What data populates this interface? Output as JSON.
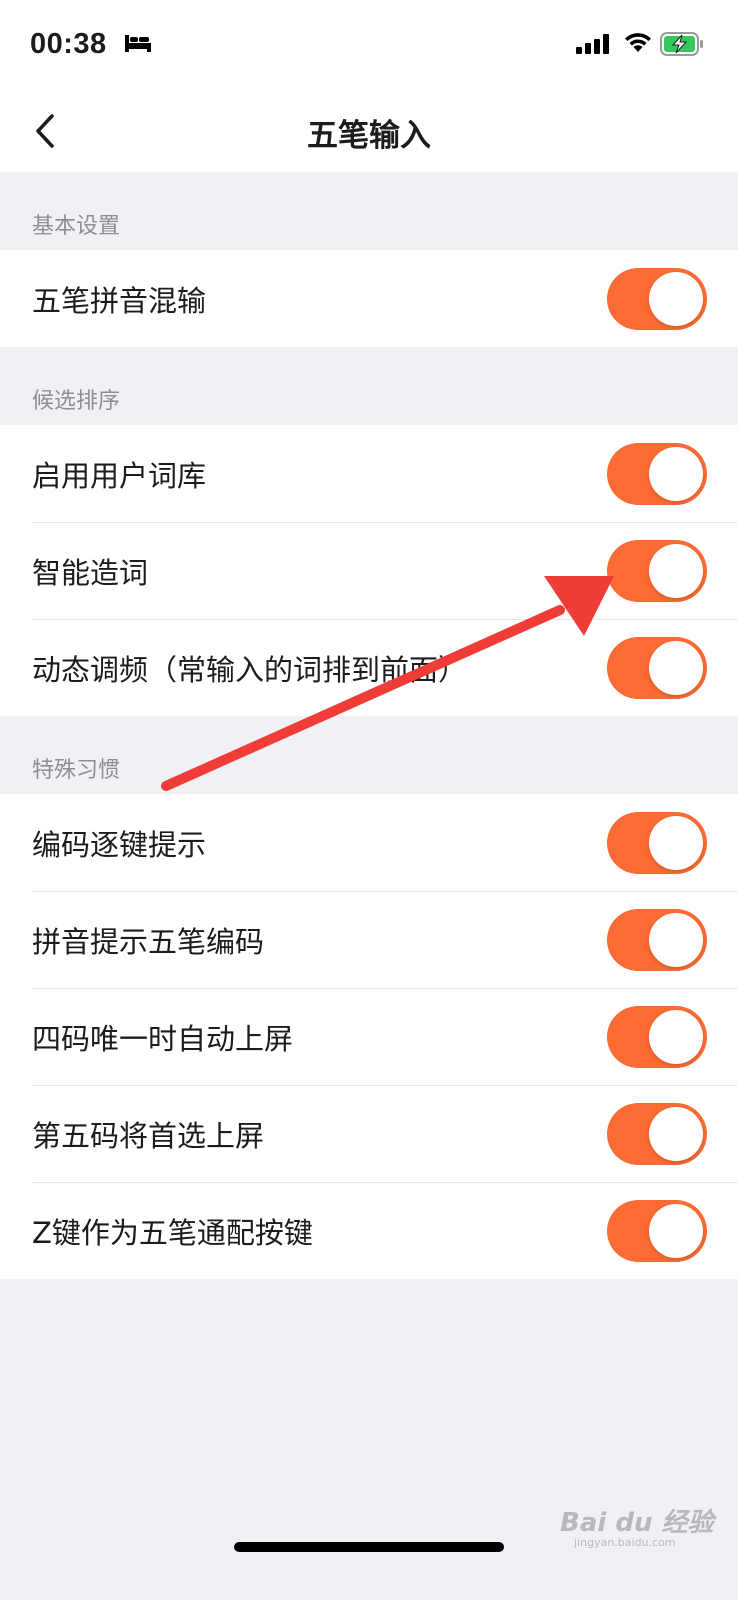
{
  "status_bar": {
    "time": "00:38",
    "icons": [
      "bed-icon",
      "signal-icon",
      "wifi-icon",
      "battery-charging-icon"
    ]
  },
  "nav": {
    "title": "五笔输入",
    "back_icon": "chevron-left-icon"
  },
  "sections": [
    {
      "header": "基本设置",
      "items": [
        {
          "label": "五笔拼音混输",
          "on": true
        }
      ]
    },
    {
      "header": "候选排序",
      "items": [
        {
          "label": "启用用户词库",
          "on": true
        },
        {
          "label": "智能造词",
          "on": true
        },
        {
          "label": "动态调频（常输入的词排到前面）",
          "on": true
        }
      ]
    },
    {
      "header": "特殊习惯",
      "items": [
        {
          "label": "编码逐键提示",
          "on": true
        },
        {
          "label": "拼音提示五笔编码",
          "on": true
        },
        {
          "label": "四码唯一时自动上屏",
          "on": true
        },
        {
          "label": "第五码将首选上屏",
          "on": true
        },
        {
          "label": "Z键作为五笔通配按键",
          "on": true
        }
      ]
    }
  ],
  "colors": {
    "accent": "#fb6b34",
    "background": "#f0f0f5",
    "arrow": "#f03c37"
  },
  "watermark": {
    "brand": "Bai du 经验",
    "sub": "jingyan.baidu.com"
  }
}
